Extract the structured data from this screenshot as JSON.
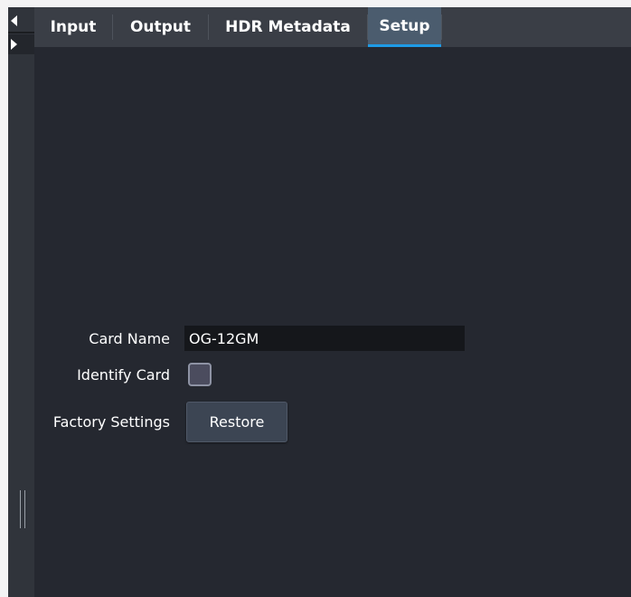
{
  "tabs": [
    {
      "label": "Input",
      "active": false
    },
    {
      "label": "Output",
      "active": false
    },
    {
      "label": "HDR Metadata",
      "active": false
    },
    {
      "label": "Setup",
      "active": true
    }
  ],
  "setup": {
    "card_name_label": "Card Name",
    "card_name_value": "OG-12GM",
    "identify_card_label": "Identify Card",
    "identify_card_checked": false,
    "factory_settings_label": "Factory Settings",
    "restore_label": "Restore"
  },
  "icons": {
    "nav_prev": "triangle-left-icon",
    "nav_next": "triangle-right-icon",
    "resize": "resize-grip-icon"
  },
  "colors": {
    "accent": "#1e9be6",
    "panel": "#252830",
    "tab_bar": "#3a3e46",
    "active_tab": "#4b5c6e"
  }
}
